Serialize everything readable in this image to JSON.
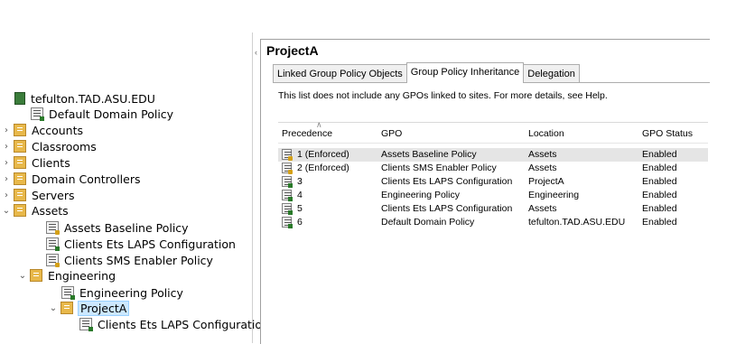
{
  "tree": {
    "domain": "tefulton.TAD.ASU.EDU",
    "items": [
      {
        "label": "Default Domain Policy"
      },
      {
        "label": "Accounts"
      },
      {
        "label": "Classrooms"
      },
      {
        "label": "Clients"
      },
      {
        "label": "Domain Controllers"
      },
      {
        "label": "Servers"
      },
      {
        "label": "Assets"
      },
      {
        "label": "Assets Baseline Policy"
      },
      {
        "label": "Clients Ets LAPS Configuration"
      },
      {
        "label": "Clients SMS Enabler Policy"
      },
      {
        "label": "Engineering"
      },
      {
        "label": "Engineering Policy"
      },
      {
        "label": "ProjectA"
      },
      {
        "label": "Clients Ets LAPS Configuration"
      }
    ]
  },
  "pane": {
    "title": "ProjectA",
    "tabs": [
      "Linked Group Policy Objects",
      "Group Policy Inheritance",
      "Delegation"
    ],
    "active_tab": "Group Policy Inheritance",
    "description": "This list does not include any GPOs linked to sites. For more details, see Help.",
    "columns": [
      "Precedence",
      "GPO",
      "Location",
      "GPO Status"
    ],
    "rows": [
      {
        "precedence": "1 (Enforced)",
        "gpo": "Assets Baseline Policy",
        "location": "Assets",
        "status": "Enabled"
      },
      {
        "precedence": "2 (Enforced)",
        "gpo": "Clients SMS Enabler Policy",
        "location": "Assets",
        "status": "Enabled"
      },
      {
        "precedence": "3",
        "gpo": "Clients Ets LAPS Configuration",
        "location": "ProjectA",
        "status": "Enabled"
      },
      {
        "precedence": "4",
        "gpo": "Engineering Policy",
        "location": "Engineering",
        "status": "Enabled"
      },
      {
        "precedence": "5",
        "gpo": "Clients Ets LAPS Configuration",
        "location": "Assets",
        "status": "Enabled"
      },
      {
        "precedence": "6",
        "gpo": "Default Domain Policy",
        "location": "tefulton.TAD.ASU.EDU",
        "status": "Enabled"
      }
    ]
  },
  "colors": {
    "selection": "#cce8ff",
    "folder": "#e8b84a",
    "row_highlight": "#e5e5e5"
  }
}
